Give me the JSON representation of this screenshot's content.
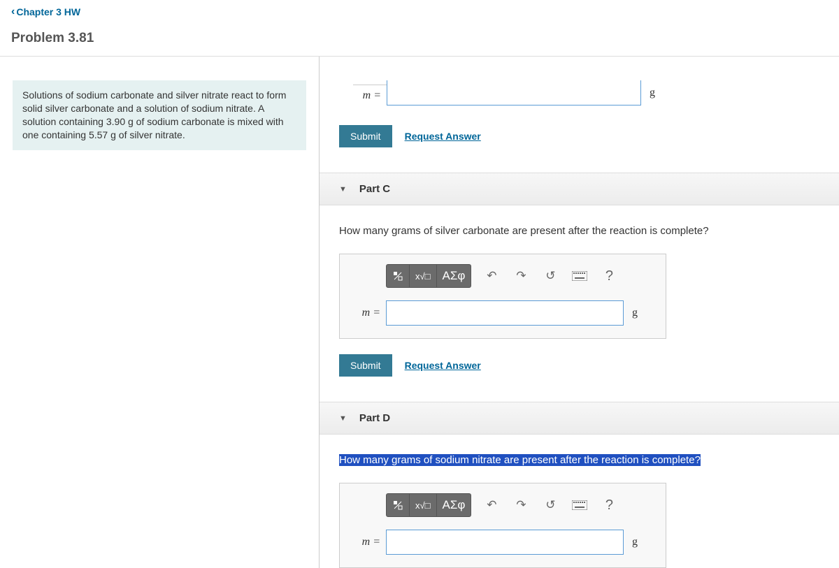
{
  "nav": {
    "back_label": "Chapter 3 HW"
  },
  "problem": {
    "title": "Problem 3.81"
  },
  "question": {
    "text": "Solutions of sodium carbonate and silver nitrate react to form solid silver carbonate and a solution of sodium nitrate. A solution containing 3.90 g of sodium carbonate is mixed with one containing 5.57 g of silver nitrate."
  },
  "buttons": {
    "submit": "Submit",
    "request_answer": "Request Answer"
  },
  "labels": {
    "m_eq": "m =",
    "m_eq_cut": "m =",
    "unit_g": "g"
  },
  "toolbar": {
    "greek": "ΑΣφ",
    "help": "?"
  },
  "partB_tail": {
    "var": "m =",
    "unit": "g"
  },
  "partC": {
    "title": "Part C",
    "question": "How many grams of silver carbonate are present after the reaction is complete?"
  },
  "partD": {
    "title": "Part D",
    "question": "How many grams of sodium nitrate are present after the reaction is complete?"
  }
}
